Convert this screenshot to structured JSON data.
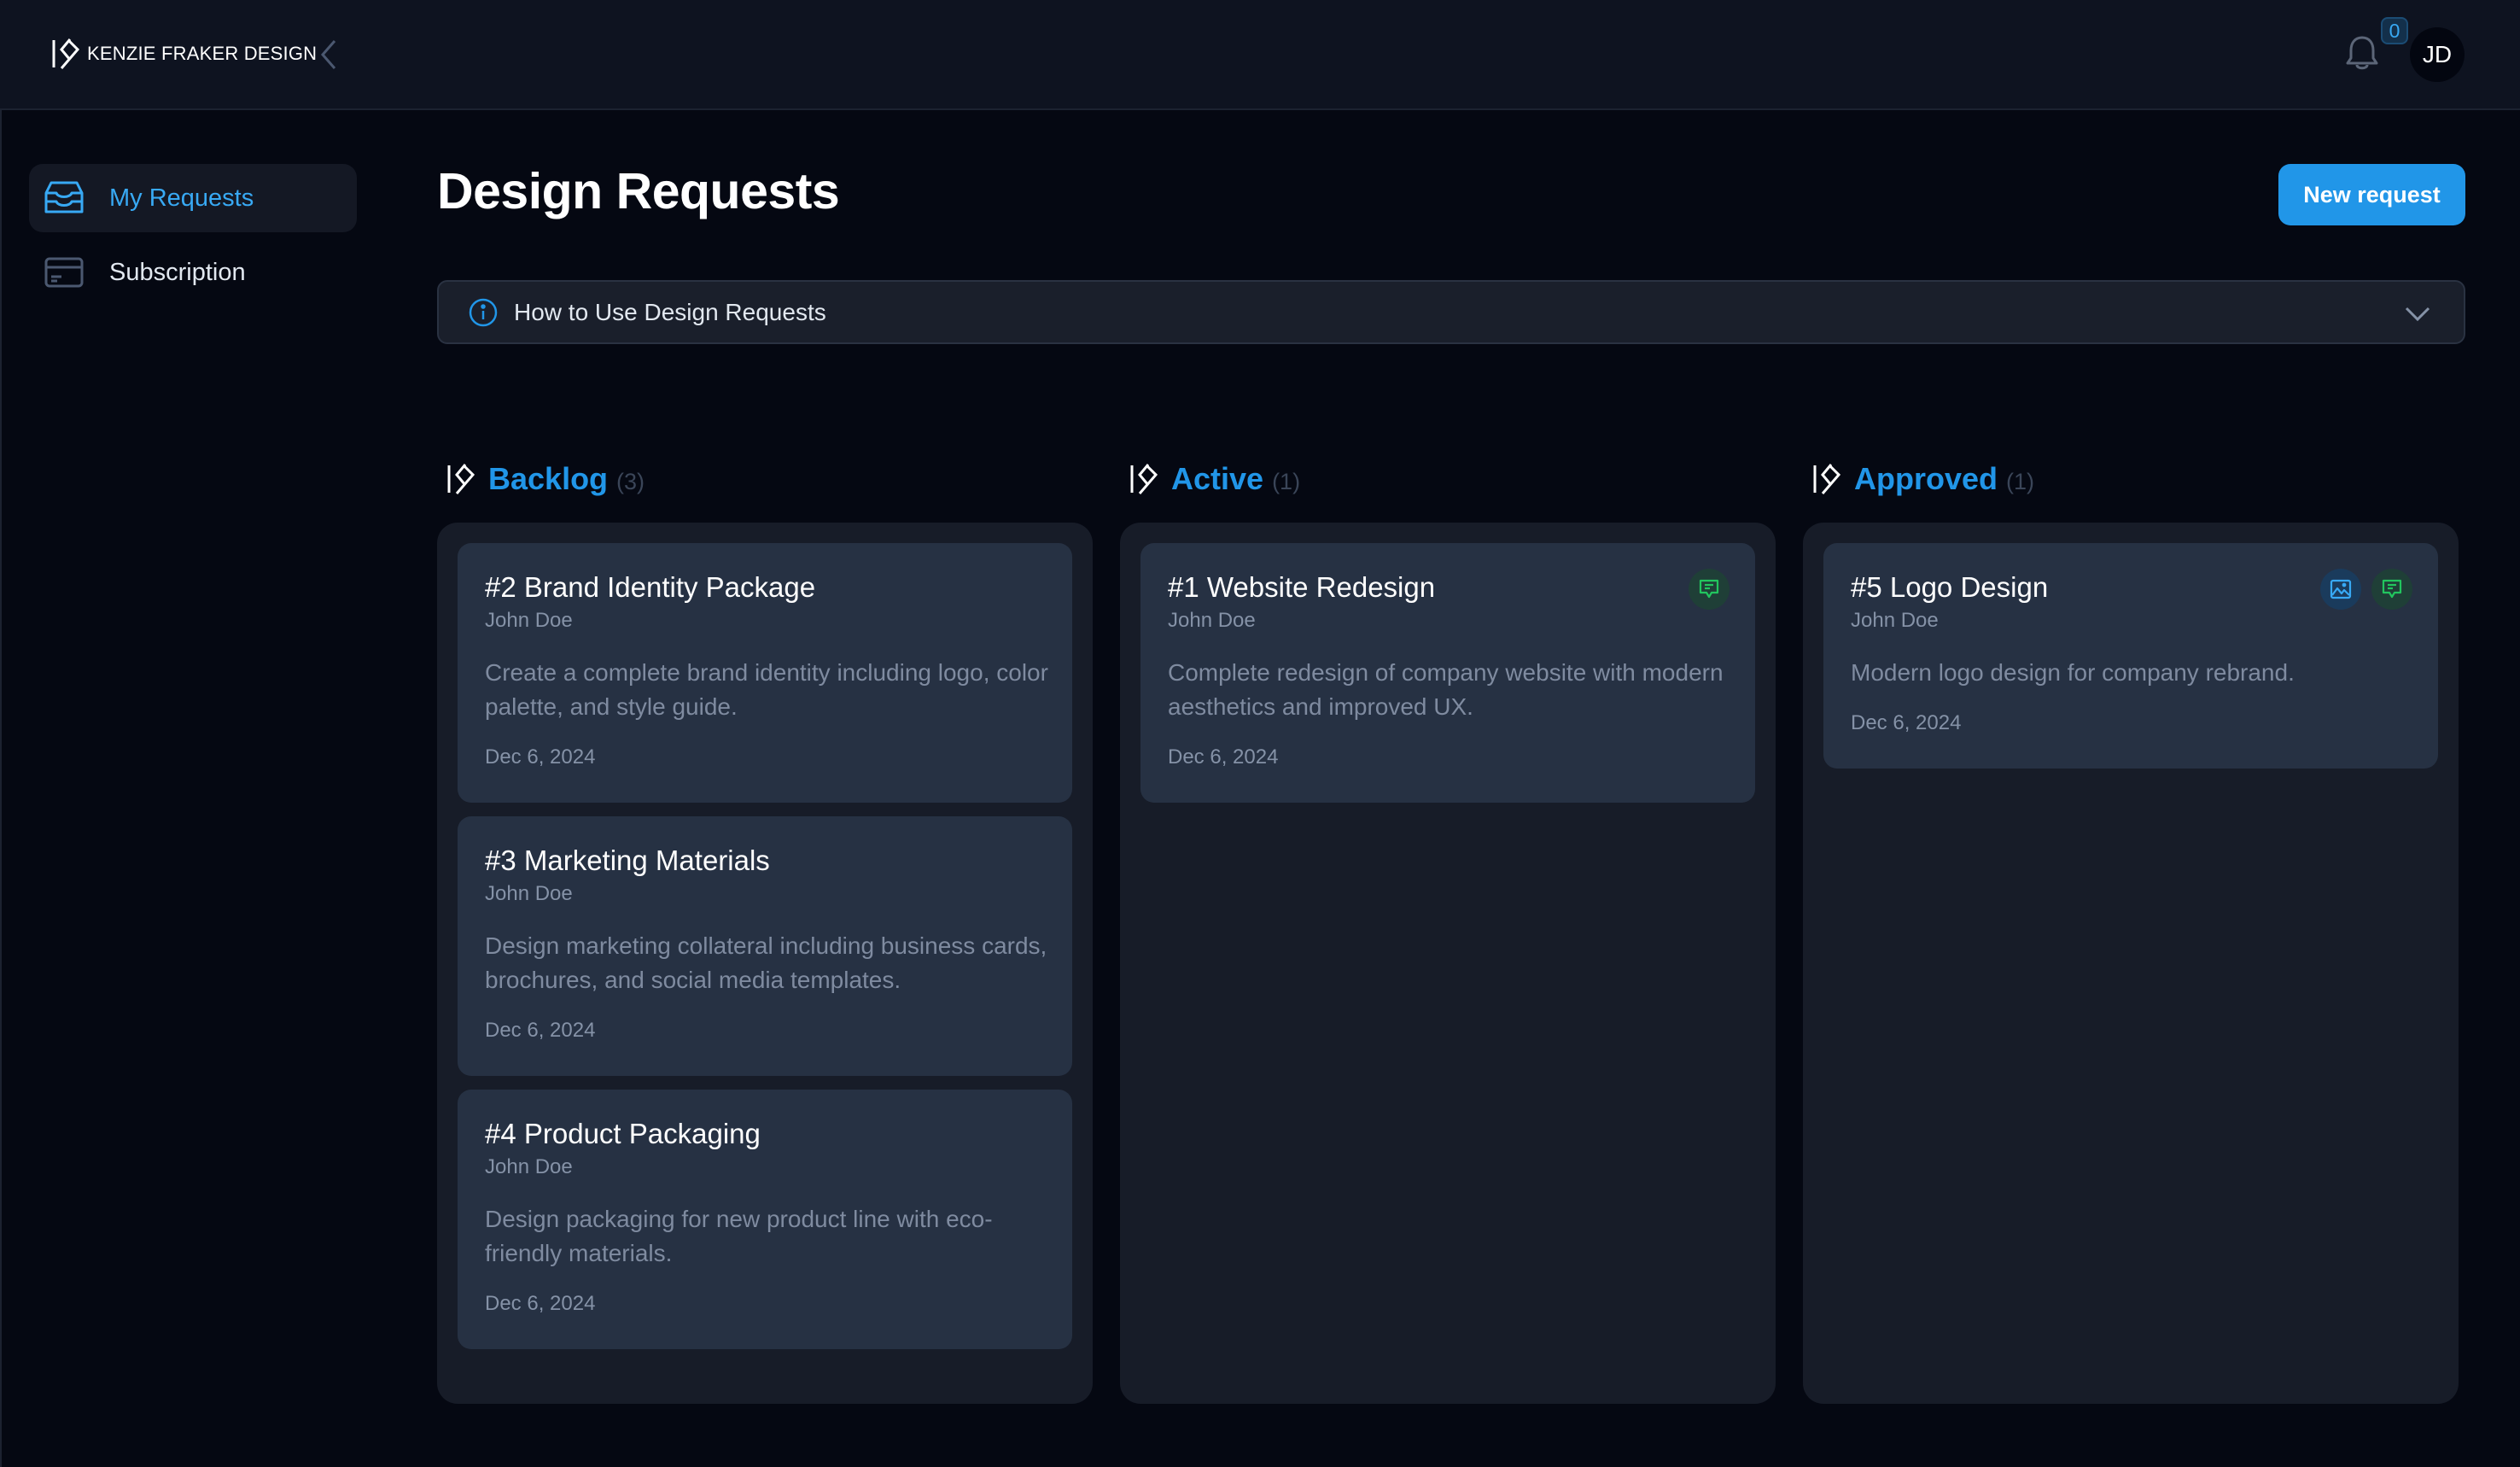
{
  "brand": {
    "name": "KENZIE FRAKER DESIGN",
    "logo_icon": "kf-monogram-icon"
  },
  "header": {
    "collapse_icon": "chevron-left-icon",
    "notifications": {
      "icon": "bell-icon",
      "count": "0"
    },
    "user": {
      "initials": "JD"
    }
  },
  "sidebar": {
    "items": [
      {
        "label": "My Requests",
        "icon": "inbox-icon",
        "active": true
      },
      {
        "label": "Subscription",
        "icon": "credit-card-icon",
        "active": false
      }
    ]
  },
  "page": {
    "title": "Design Requests",
    "new_request_label": "New request",
    "help": {
      "label": "How to Use Design Requests",
      "icon": "info-icon",
      "expand_icon": "chevron-down-icon"
    }
  },
  "colors": {
    "accent": "#2196e8",
    "comment_badge": "#22c55e",
    "image_badge": "#38a9f4"
  },
  "columns": [
    {
      "title": "Backlog",
      "count": "(3)",
      "cards": [
        {
          "title": "#2 Brand Identity Package",
          "author": "John Doe",
          "description": "Create a complete brand identity including logo, color palette, and style guide.",
          "date": "Dec 6, 2024",
          "icons": []
        },
        {
          "title": "#3 Marketing Materials",
          "author": "John Doe",
          "description": "Design marketing collateral including business cards, brochures, and social media templates.",
          "date": "Dec 6, 2024",
          "icons": []
        },
        {
          "title": "#4 Product Packaging",
          "author": "John Doe",
          "description": "Design packaging for new product line with eco-friendly materials.",
          "date": "Dec 6, 2024",
          "icons": []
        }
      ]
    },
    {
      "title": "Active",
      "count": "(1)",
      "cards": [
        {
          "title": "#1 Website Redesign",
          "author": "John Doe",
          "description": "Complete redesign of company website with modern aesthetics and improved UX.",
          "date": "Dec 6, 2024",
          "icons": [
            "comment-icon"
          ]
        }
      ]
    },
    {
      "title": "Approved",
      "count": "(1)",
      "cards": [
        {
          "title": "#5 Logo Design",
          "author": "John Doe",
          "description": "Modern logo design for company rebrand.",
          "date": "Dec 6, 2024",
          "icons": [
            "image-icon",
            "comment-icon"
          ]
        }
      ]
    }
  ]
}
